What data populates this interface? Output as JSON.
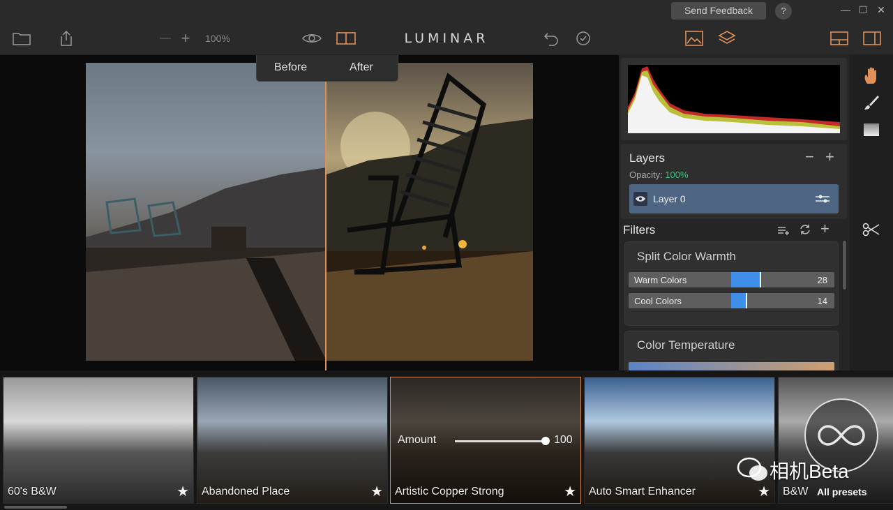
{
  "titlebar": {
    "feedback_label": "Send Feedback",
    "help_label": "?",
    "minimize": "—",
    "maximize": "☐",
    "close": "✕"
  },
  "toolbar": {
    "zoom_level": "100%",
    "zoom_in": "+",
    "brand": "LUMINAR",
    "accent": "#e0915a"
  },
  "compare": {
    "before_label": "Before",
    "after_label": "After"
  },
  "layers": {
    "title": "Layers",
    "remove": "−",
    "add": "+",
    "opacity_label": "Opacity:",
    "opacity_value": "100%",
    "layer_name": "Layer 0"
  },
  "filters": {
    "title": "Filters",
    "add": "+",
    "cards": [
      {
        "title": "Split Color Warmth",
        "sliders": [
          {
            "label": "Warm Colors",
            "value": 28,
            "display": "28"
          },
          {
            "label": "Cool Colors",
            "value": 14,
            "display": "14"
          }
        ]
      },
      {
        "title": "Color Temperature"
      }
    ]
  },
  "presets": {
    "items": [
      {
        "name": "60's B&W"
      },
      {
        "name": "Abandoned Place"
      },
      {
        "name": "Artistic Copper Strong"
      },
      {
        "name": "Auto Smart Enhancer"
      },
      {
        "name": "B&W"
      }
    ],
    "amount_label": "Amount",
    "amount_value": "100",
    "amount_fraction": 1.0,
    "star": "★",
    "all_presets_label": "All presets"
  },
  "watermark": "相机Beta"
}
